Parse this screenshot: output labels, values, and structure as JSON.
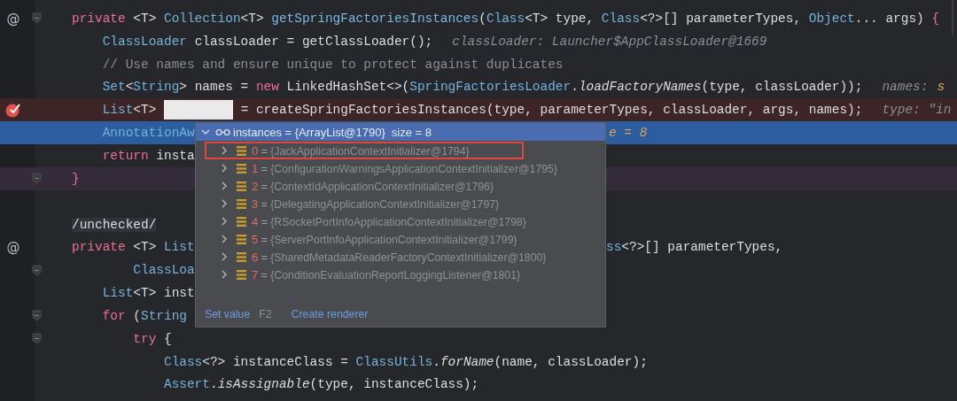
{
  "editor": {
    "lines": [
      {
        "gutter": "@",
        "breakpoint": false,
        "current": false,
        "caret": false,
        "fold": true,
        "tokens": [
          {
            "kind": "kw",
            "text": "private "
          },
          {
            "kind": "plain",
            "text": "<T> "
          },
          {
            "kind": "type",
            "text": "Collection"
          },
          {
            "kind": "plain",
            "text": "<T> "
          },
          {
            "kind": "decl",
            "text": "getSpringFactoriesInstances"
          },
          {
            "kind": "plain",
            "text": "("
          },
          {
            "kind": "type",
            "text": "Class"
          },
          {
            "kind": "plain",
            "text": "<T> type, "
          },
          {
            "kind": "type",
            "text": "Class"
          },
          {
            "kind": "plain",
            "text": "<?>[] parameterTypes, "
          },
          {
            "kind": "type",
            "text": "Object"
          },
          {
            "kind": "plain",
            "text": "... args) "
          },
          {
            "kind": "brace",
            "text": "{"
          }
        ]
      },
      {
        "breakpoint": false,
        "current": false,
        "caret": false,
        "fold": false,
        "tokens": [
          {
            "kind": "type",
            "text": "    ClassLoader"
          },
          {
            "kind": "plain",
            "text": " classLoader = getClassLoader();"
          },
          {
            "kind": "hint",
            "text": "classLoader: Launcher$AppClassLoader@1669"
          }
        ]
      },
      {
        "breakpoint": false,
        "current": false,
        "caret": false,
        "fold": false,
        "tokens": [
          {
            "kind": "comment",
            "text": "    // Use names and ensure unique to protect against duplicates"
          }
        ]
      },
      {
        "breakpoint": false,
        "current": false,
        "caret": false,
        "fold": false,
        "tokens": [
          {
            "kind": "type",
            "text": "    Set"
          },
          {
            "kind": "plain",
            "text": "<"
          },
          {
            "kind": "type",
            "text": "String"
          },
          {
            "kind": "plain",
            "text": "> names = "
          },
          {
            "kind": "kw",
            "text": "new"
          },
          {
            "kind": "plain",
            "text": " LinkedHashSet<>("
          },
          {
            "kind": "type",
            "text": "SpringFactoriesLoader"
          },
          {
            "kind": "plain",
            "text": "."
          },
          {
            "kind": "static",
            "text": "loadFactoryNames"
          },
          {
            "kind": "plain",
            "text": "(type, classLoader));"
          },
          {
            "kind": "hint",
            "text": "names:"
          },
          {
            "kind": "hintval",
            "text": "s"
          }
        ]
      },
      {
        "breakpoint": true,
        "current": false,
        "caret": false,
        "fold": false,
        "tokens": [
          {
            "kind": "type",
            "text": "    List"
          },
          {
            "kind": "plain",
            "text": "<T> "
          },
          {
            "kind": "redaction"
          },
          {
            "kind": "plain",
            "text": " = createSpringFactoriesInstances(type, parameterTypes, classLoader, args, names);"
          },
          {
            "kind": "hint",
            "text": "type: \"in"
          }
        ]
      },
      {
        "breakpoint": false,
        "current": true,
        "caret": false,
        "fold": false,
        "tokens": [
          {
            "kind": "type",
            "text": "    AnnotationAw"
          }
        ],
        "right": [
          {
            "kind": "hintval",
            "text": "e = 8"
          }
        ]
      },
      {
        "breakpoint": false,
        "current": false,
        "caret": false,
        "fold": false,
        "tokens": [
          {
            "kind": "kw",
            "text": "    return"
          },
          {
            "kind": "plain",
            "text": " insta"
          }
        ]
      },
      {
        "breakpoint": false,
        "current": false,
        "caret": true,
        "fold": true,
        "tokens": [
          {
            "kind": "brace",
            "text": "}"
          }
        ]
      },
      {
        "breakpoint": false,
        "current": false,
        "caret": false,
        "fold": false
      },
      {
        "breakpoint": false,
        "current": false,
        "caret": false,
        "fold": false,
        "tokens": [
          {
            "kind": "folded",
            "text": "/unchecked/"
          }
        ]
      },
      {
        "gutter": "@",
        "breakpoint": false,
        "current": false,
        "caret": false,
        "fold": false,
        "tokens": [
          {
            "kind": "kw",
            "text": "private"
          },
          {
            "kind": "plain",
            "text": " <T> "
          },
          {
            "kind": "type",
            "text": "List"
          }
        ],
        "right": [
          {
            "kind": "type",
            "text": "ss"
          },
          {
            "kind": "plain",
            "text": "<?>[] parameterTypes,"
          }
        ]
      },
      {
        "breakpoint": false,
        "current": false,
        "caret": false,
        "fold": true,
        "tokens": [
          {
            "kind": "type",
            "text": "        ClassLoa"
          }
        ]
      },
      {
        "breakpoint": false,
        "current": false,
        "caret": false,
        "fold": false,
        "tokens": [
          {
            "kind": "type",
            "text": "    List"
          },
          {
            "kind": "plain",
            "text": "<T> inst"
          }
        ]
      },
      {
        "breakpoint": false,
        "current": false,
        "caret": false,
        "fold": true,
        "tokens": [
          {
            "kind": "kw",
            "text": "    for"
          },
          {
            "kind": "plain",
            "text": " ("
          },
          {
            "kind": "type",
            "text": "String"
          }
        ]
      },
      {
        "breakpoint": false,
        "current": false,
        "caret": false,
        "fold": true,
        "tokens": [
          {
            "kind": "kw",
            "text": "        try"
          },
          {
            "kind": "plain",
            "text": " {"
          }
        ]
      },
      {
        "breakpoint": false,
        "current": false,
        "caret": false,
        "fold": false,
        "tokens": [
          {
            "kind": "type",
            "text": "            Class"
          },
          {
            "kind": "plain",
            "text": "<?> instanceClass = "
          },
          {
            "kind": "type",
            "text": "ClassUtils"
          },
          {
            "kind": "plain",
            "text": "."
          },
          {
            "kind": "static",
            "text": "forName"
          },
          {
            "kind": "plain",
            "text": "(name, classLoader);"
          }
        ]
      },
      {
        "breakpoint": false,
        "current": false,
        "caret": false,
        "fold": false,
        "tokens": [
          {
            "kind": "type",
            "text": "            Assert"
          },
          {
            "kind": "plain",
            "text": "."
          },
          {
            "kind": "static",
            "text": "isAssignable"
          },
          {
            "kind": "plain",
            "text": "(type, instanceClass);"
          }
        ]
      }
    ]
  },
  "popup": {
    "header": {
      "label": "instances = {ArrayList@1790}",
      "size": "size = 8",
      "expanded": true
    },
    "items": [
      {
        "index": "0",
        "operator": "=",
        "value": "{JackApplicationContextInitializer@1794}",
        "outlined": true
      },
      {
        "index": "1",
        "operator": "=",
        "value": "{ConfigurationWarningsApplicationContextInitializer@1795}",
        "outlined": false
      },
      {
        "index": "2",
        "operator": "=",
        "value": "{ContextIdApplicationContextInitializer@1796}",
        "outlined": false
      },
      {
        "index": "3",
        "operator": "=",
        "value": "{DelegatingApplicationContextInitializer@1797}",
        "outlined": false
      },
      {
        "index": "4",
        "operator": "=",
        "value": "{RSocketPortInfoApplicationContextInitializer@1798}",
        "outlined": false
      },
      {
        "index": "5",
        "operator": "=",
        "value": "{ServerPortInfoApplicationContextInitializer@1799}",
        "outlined": false
      },
      {
        "index": "6",
        "operator": "=",
        "value": "{SharedMetadataReaderFactoryContextInitializer@1800}",
        "outlined": false
      },
      {
        "index": "7",
        "operator": "=",
        "value": "{ConditionEvaluationReportLoggingListener@1801}",
        "outlined": false
      }
    ],
    "footer": [
      {
        "label": "Set value",
        "shortcut": "F2"
      },
      {
        "label": "Create renderer"
      }
    ]
  }
}
